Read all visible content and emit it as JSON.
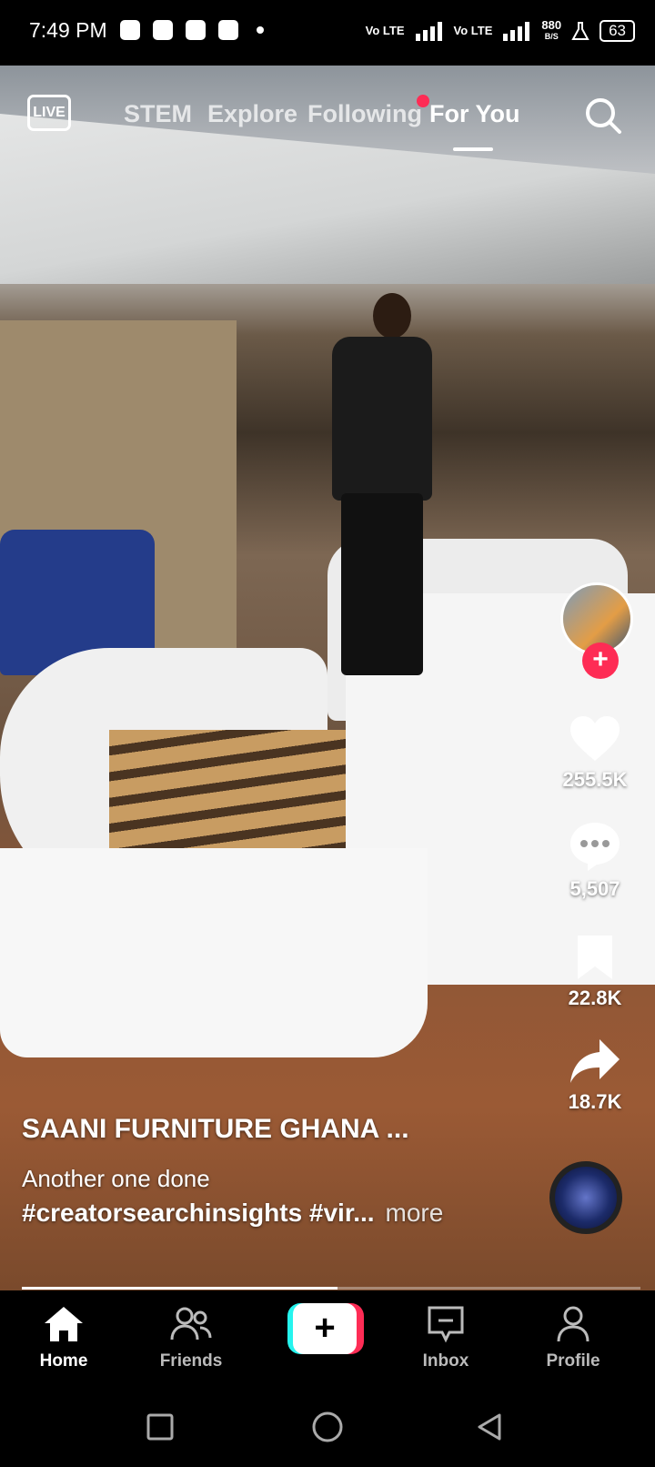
{
  "status_bar": {
    "time": "7:49 PM",
    "network_1": "Vo LTE",
    "network_2": "Vo LTE",
    "speed": "880",
    "speed_unit": "B/S",
    "battery": "63"
  },
  "top_nav": {
    "live_label": "LIVE",
    "tabs": [
      {
        "label": "STEM"
      },
      {
        "label": "Explore"
      },
      {
        "label": "Following"
      },
      {
        "label": "For You"
      }
    ],
    "active_tab": "For You"
  },
  "actions": {
    "likes": "255.5K",
    "comments": "5,507",
    "saves": "22.8K",
    "shares": "18.7K"
  },
  "caption": {
    "username": "SAANI FURNITURE GHANA ...",
    "text": "Another one done",
    "hashtags": "#creatorsearchinsights #vir...",
    "more": "more"
  },
  "progress": 0.51,
  "bottom_nav": {
    "items": [
      {
        "label": "Home"
      },
      {
        "label": "Friends"
      },
      {
        "label": "Inbox"
      },
      {
        "label": "Profile"
      }
    ],
    "active": "Home"
  },
  "colors": {
    "accent": "#fe2c55",
    "cyan": "#25f4ee"
  }
}
